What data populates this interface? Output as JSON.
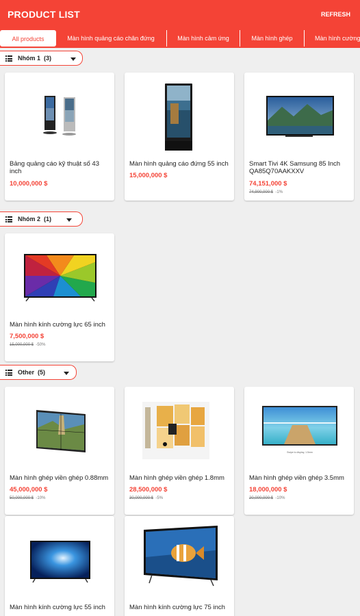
{
  "app_bar": {
    "title": "PRODUCT LIST",
    "refresh_label": "REFRESH"
  },
  "tabs": [
    {
      "label": "All products"
    },
    {
      "label": "Màn hình quảng cáo chân đứng"
    },
    {
      "label": "Màn hình cảm ứng"
    },
    {
      "label": "Màn hình ghép"
    },
    {
      "label": "Màn hình cường lực"
    }
  ],
  "groups": [
    {
      "label": "Nhóm 1",
      "count": "(3)"
    },
    {
      "label": "Nhóm 2",
      "count": "(1)"
    },
    {
      "label": "Other",
      "count": "(5)"
    }
  ],
  "products": [
    {
      "name": "Bảng quảng cáo kỹ thuật số 43 inch",
      "price": "10,000,000 $",
      "old_price": "",
      "discount": ""
    },
    {
      "name": "Màn hình quảng cáo đứng 55 inch",
      "price": "15,000,000 $",
      "old_price": "",
      "discount": ""
    },
    {
      "name": "Smart Tivi 4K Samsung 85 Inch QA85Q70AAKXXV",
      "price": "74,151,000 $",
      "old_price": "74,900,000 $",
      "discount": "-1%"
    },
    {
      "name": "Màn hình kính cường lực 65 inch",
      "price": "7,500,000 $",
      "old_price": "15,000,000 $",
      "discount": "-50%"
    },
    {
      "name": "Màn hình ghép viền ghép 0.88mm",
      "price": "45,000,000 $",
      "old_price": "50,000,000 $",
      "discount": "-10%"
    },
    {
      "name": "Màn hình ghép viền ghép 1.8mm",
      "price": "28,500,000 $",
      "old_price": "30,000,000 $",
      "discount": "-5%"
    },
    {
      "name": "Màn hình ghép viền ghép 3.5mm",
      "price": "18,000,000 $",
      "old_price": "20,000,000 $",
      "discount": "-10%"
    },
    {
      "name": "Màn hình kính cường lực 55 inch",
      "price": "",
      "old_price": "",
      "discount": ""
    },
    {
      "name": "Màn hình kính cường lực 75 inch",
      "price": "",
      "old_price": "",
      "discount": ""
    }
  ],
  "thumb_caption": "Swipe to display, 1.5mm",
  "colors": {
    "accent": "#f44336",
    "background": "#efefef",
    "card": "#ffffff"
  }
}
